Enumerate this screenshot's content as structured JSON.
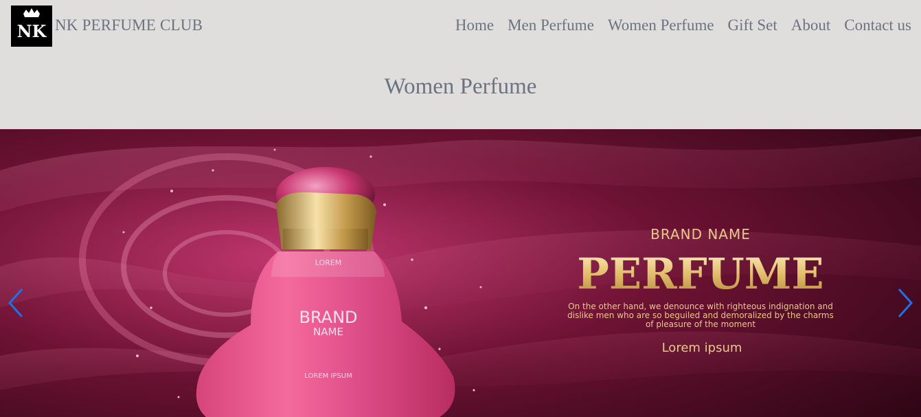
{
  "nav": {
    "logo_text": "NK",
    "brand": "NK PERFUME CLUB",
    "links": [
      "Home",
      "Men Perfume",
      "Women Perfume",
      "Gift Set",
      "About",
      "Contact us"
    ]
  },
  "page": {
    "title": "Women Perfume"
  },
  "hero": {
    "bottle_top": "LOREM",
    "bottle_brand": "BRAND",
    "bottle_name": "NAME",
    "bottle_bottom": "LOREM IPSUM",
    "brand_name": "BRAND NAME",
    "headline": "PERFUME",
    "desc_line1": "On the other hand, we denounce with righteous indignation and",
    "desc_line2": "dislike men who are so beguiled and demoralized by the charms",
    "desc_line3": "of pleasure of the moment",
    "tagline": "Lorem ipsum"
  },
  "colors": {
    "background": "#e0dedd",
    "text_muted": "#6b7380",
    "arrow": "#1a73e8",
    "gold": "#e8c98a"
  },
  "icons": {
    "prev": "chevron-left-icon",
    "next": "chevron-right-icon"
  }
}
